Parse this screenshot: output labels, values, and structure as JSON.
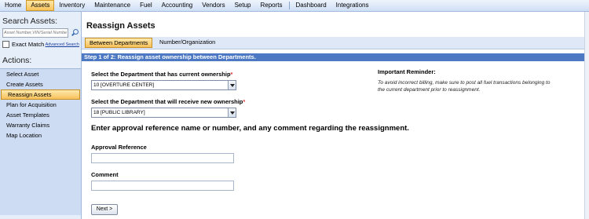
{
  "topnav": {
    "items": [
      {
        "label": "Home",
        "active": false
      },
      {
        "label": "Assets",
        "active": true
      },
      {
        "label": "Inventory",
        "active": false
      },
      {
        "label": "Maintenance",
        "active": false
      },
      {
        "label": "Fuel",
        "active": false
      },
      {
        "label": "Accounting",
        "active": false
      },
      {
        "label": "Vendors",
        "active": false
      },
      {
        "label": "Setup",
        "active": false
      },
      {
        "label": "Reports",
        "active": false
      },
      {
        "label": "Dashboard",
        "active": false
      },
      {
        "label": "Integrations",
        "active": false
      }
    ]
  },
  "sidebar": {
    "search_title": "Search Assets:",
    "search_placeholder": "Asset Number,VIN/Serial Numbe",
    "exact_match_label": "Exact Match",
    "advanced_search_label": "Advanced Search",
    "actions_title": "Actions:",
    "actions": [
      {
        "label": "Select Asset",
        "active": false
      },
      {
        "label": "Create Assets",
        "active": false
      },
      {
        "label": "Reassign Assets",
        "active": true
      },
      {
        "label": "Plan for Acquisition",
        "active": false
      },
      {
        "label": "Asset Templates",
        "active": false
      },
      {
        "label": "Warranty Claims",
        "active": false
      },
      {
        "label": "Map Location",
        "active": false
      }
    ]
  },
  "main": {
    "title": "Reassign Assets",
    "tabs": [
      {
        "label": "Between Departments",
        "active": true
      },
      {
        "label": "Number/Organization",
        "active": false
      }
    ],
    "step_bar": "Step 1 of 2: Reassign asset ownership between Departments.",
    "current_dept_label": "Select the Department that has current ownership",
    "current_dept_value": "10 [OVERTURE CENTER]",
    "new_dept_label": "Select the Department that will receive new ownership",
    "new_dept_value": "18 [PUBLIC LIBRARY]",
    "required_mark": "*",
    "approval_heading": "Enter approval reference name or number, and any comment regarding the reassignment.",
    "approval_ref_label": "Approval Reference",
    "approval_ref_value": "",
    "comment_label": "Comment",
    "comment_value": "",
    "next_button": "Next >",
    "reminder_title": "Important Reminder:",
    "reminder_text": "To avoid incorrect billing, make sure to post all fuel transactions belonging to the current department prior to reassignment."
  }
}
